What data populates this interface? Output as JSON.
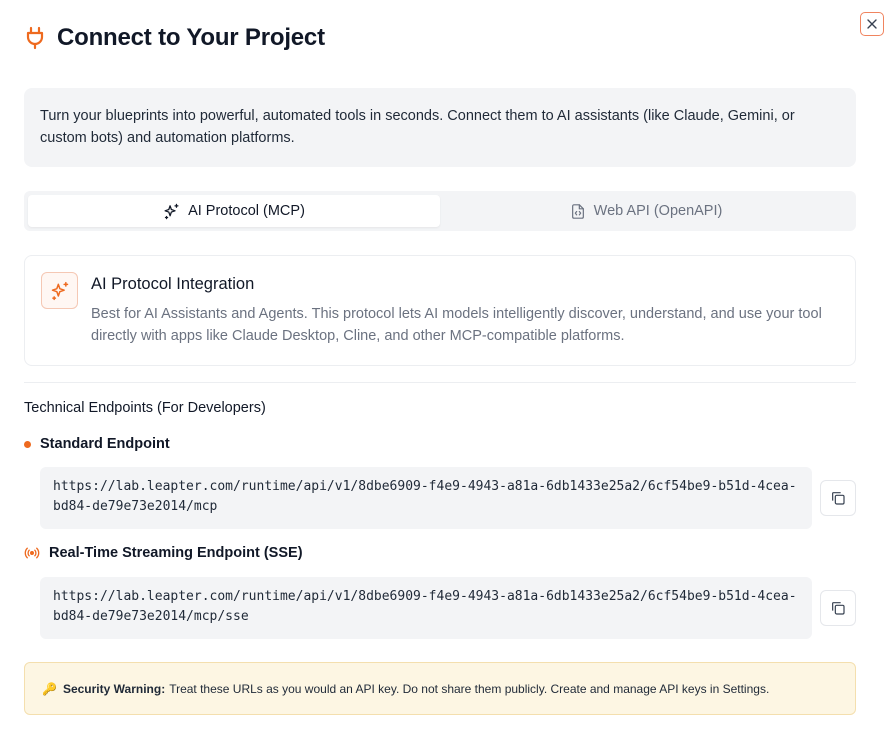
{
  "dialog": {
    "title": "Connect to Your Project",
    "close_label": "Close"
  },
  "intro": {
    "text": "Turn your blueprints into powerful, automated tools in seconds. Connect them to AI assistants (like Claude, Gemini, or custom bots) and automation platforms."
  },
  "tabs": [
    {
      "label": "AI Protocol (MCP)",
      "icon": "sparkles-icon",
      "active": true
    },
    {
      "label": "Web API (OpenAPI)",
      "icon": "file-code-icon",
      "active": false
    }
  ],
  "integration": {
    "title": "AI Protocol Integration",
    "description": "Best for AI Assistants and Agents. This protocol lets AI models intelligently discover, understand, and use your tool directly with apps like Claude Desktop, Cline, and other MCP-compatible platforms."
  },
  "endpoints": {
    "section_title": "Technical Endpoints (For Developers)",
    "standard": {
      "label": "Standard Endpoint",
      "url": "https://lab.leapter.com/runtime/api/v1/8dbe6909-f4e9-4943-a81a-6db1433e25a2/6cf54be9-b51d-4cea-bd84-de79e73e2014/mcp"
    },
    "sse": {
      "label": "Real-Time Streaming Endpoint (SSE)",
      "url": "https://lab.leapter.com/runtime/api/v1/8dbe6909-f4e9-4943-a81a-6db1433e25a2/6cf54be9-b51d-4cea-bd84-de79e73e2014/mcp/sse"
    }
  },
  "warning": {
    "icon": "key-icon",
    "emoji": "🔑",
    "title": "Security Warning:",
    "text": "Treat these URLs as you would an API key. Do not share them publicly. Create and manage API keys in Settings."
  },
  "colors": {
    "accent": "#ee6a1f",
    "panel_bg": "#f3f4f6",
    "warning_bg": "#fdf6e3"
  }
}
